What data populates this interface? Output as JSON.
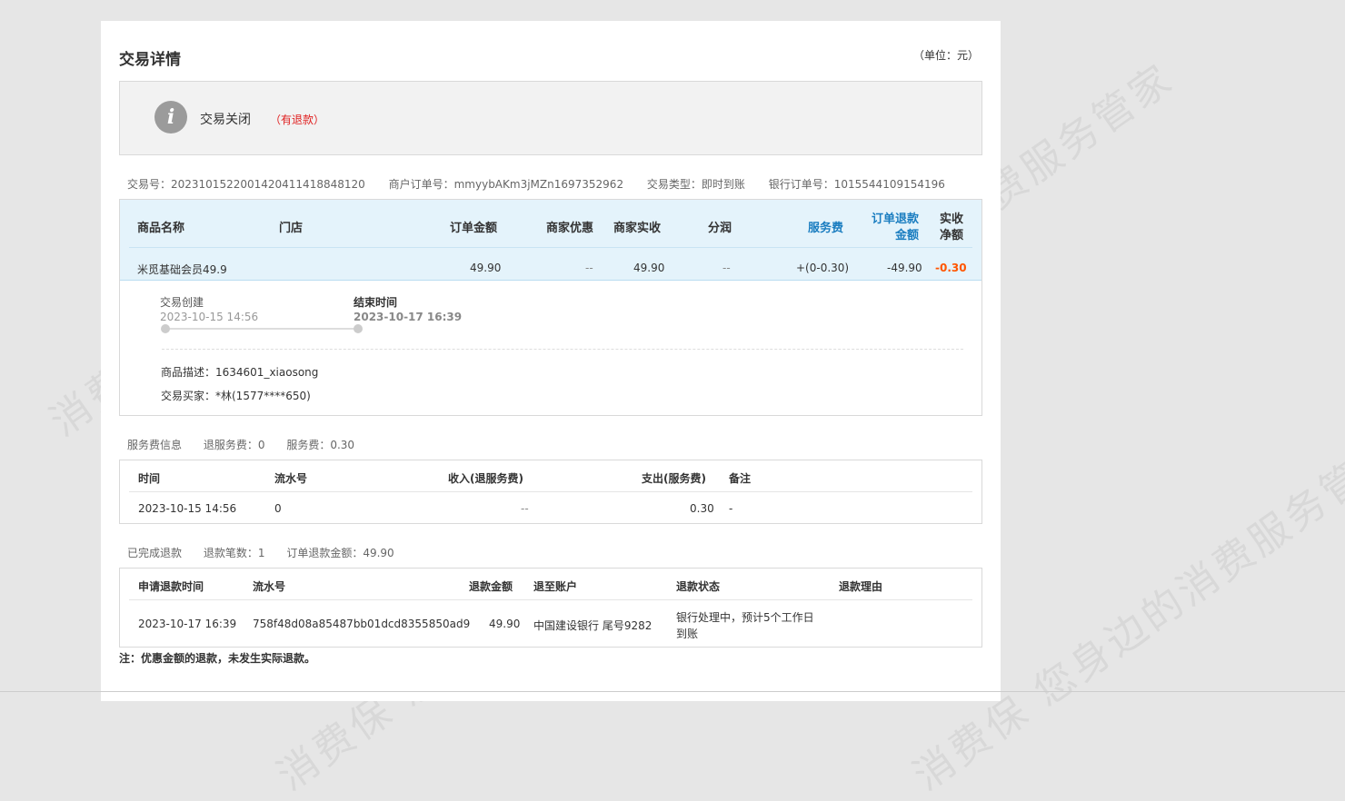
{
  "watermark": "消费保 您身边的消费服务管家",
  "page": {
    "title": "交易详情",
    "unit": "（单位：元）"
  },
  "status": {
    "text": "交易关闭",
    "note": "（有退款）",
    "icon": "info-icon"
  },
  "meta": {
    "trade_no": "交易号：2023101522001420411418848120",
    "merchant_order_no": "商户订单号：mmyybAKm3jMZn1697352962",
    "trade_type": "交易类型：即时到账",
    "bank_order_no": "银行订单号：1015544109154196"
  },
  "order": {
    "headers": {
      "name": "商品名称",
      "store": "门店",
      "amount": "订单金额",
      "discount": "商家优惠",
      "received": "商家实收",
      "share": "分润",
      "service_fee": "服务费",
      "refund_line1": "订单退款",
      "refund_line2": "金额",
      "net_line1": "实收",
      "net_line2": "净额"
    },
    "row": {
      "name": "米觅基础会员49.9",
      "amount": "49.90",
      "discount": "--",
      "received": "49.90",
      "share": "--",
      "service_fee": "+(0-0.30)",
      "refund": "-49.90",
      "net": "-0.30"
    },
    "timeline": [
      {
        "label": "交易创建",
        "date": "2023-10-15 14:56"
      },
      {
        "label": "结束时间",
        "date": "2023-10-17 16:39"
      }
    ],
    "description": "商品描述：1634601_xiaosong",
    "buyer": "交易买家：*林(1577****650)"
  },
  "service_fee_info": {
    "title": "服务费信息",
    "refund_fee": "退服务费：0",
    "fee": "服务费：0.30",
    "headers": {
      "time": "时间",
      "serial": "流水号",
      "income": "收入(退服务费)",
      "expense": "支出(服务费)",
      "remark": "备注"
    },
    "row": {
      "time": "2023-10-15 14:56",
      "serial": "0",
      "income": "--",
      "expense": "0.30",
      "remark": "-"
    }
  },
  "refund_info": {
    "title": "已完成退款",
    "count": "退款笔数：1",
    "amount": "订单退款金额：49.90",
    "headers": {
      "time": "申请退款时间",
      "serial": "流水号",
      "amount": "退款金额",
      "account": "退至账户",
      "status": "退款状态",
      "reason": "退款理由"
    },
    "row": {
      "time": "2023-10-17 16:39",
      "serial": "758f48d08a85487bb01dcd8355850ad9",
      "amount": "49.90",
      "account": "中国建设银行 尾号9282",
      "status_line1": "银行处理中，预计5个工作日",
      "status_line2": "到账",
      "reason": ""
    }
  },
  "footnote": "注：优惠金额的退款，未发生实际退款。"
}
